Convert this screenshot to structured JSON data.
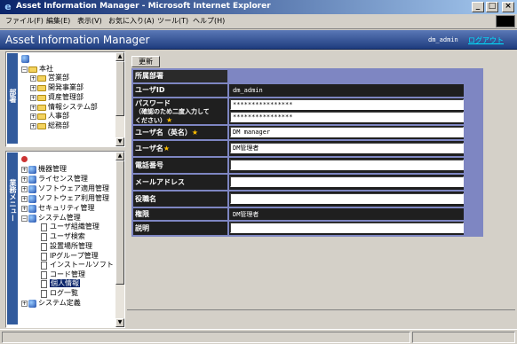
{
  "window": {
    "title": "Asset Information Manager - Microsoft Internet Explorer",
    "buttons": {
      "minimize": "_",
      "maximize": "□",
      "close": "×"
    }
  },
  "menu": [
    "ファイル(F)",
    "編集(E)",
    "表示(V)",
    "お気に入り(A)",
    "ツール(T)",
    "ヘルプ(H)"
  ],
  "header": {
    "app_title": "Asset Information Manager",
    "user": "dm_admin",
    "logout": "ログアウト"
  },
  "org_pane": {
    "tab": "部署",
    "root": "本社",
    "items": [
      "営業部",
      "開発事業部",
      "資産管理部",
      "情報システム部",
      "人事部",
      "総務部"
    ]
  },
  "menu_pane": {
    "tab": "業務メニュー",
    "items": [
      "機器管理",
      "ライセンス管理",
      "ソフトウェア適用管理",
      "ソフトウェア利用管理",
      "セキュリティ管理",
      "システム管理"
    ],
    "sub_items": [
      "ユーザ組織管理",
      "ユーザ検索",
      "設置場所管理",
      "IPグループ管理",
      "インストールソフト",
      "コード管理",
      "個人情報",
      "ログ一覧"
    ],
    "last": "システム定義"
  },
  "form": {
    "update_button": "更新",
    "section_header": "所属部署",
    "labels": {
      "user_id": "ユーザID",
      "password": "パスワード",
      "password_note": "（確認のため二度入力して",
      "password_note2": "ください）",
      "user_name_en": "ユーザ名（英名）",
      "user_name": "ユーザ名",
      "phone": "電話番号",
      "email": "メールアドレス",
      "title": "役職名",
      "authority": "権限",
      "description": "説明"
    },
    "required_mark": "★",
    "values": {
      "user_id": "dm_admin",
      "password1": "****************",
      "password2": "****************",
      "user_name_en": "DM manager",
      "user_name": "DM管理者",
      "phone": "",
      "email": "",
      "title": "",
      "authority": "DM管理者",
      "description": ""
    }
  },
  "colors": {
    "header_bg": "#1e3c7e",
    "form_bg": "#7e86c2",
    "label_bg": "#1f1f1f",
    "logout": "#00e4ff"
  }
}
